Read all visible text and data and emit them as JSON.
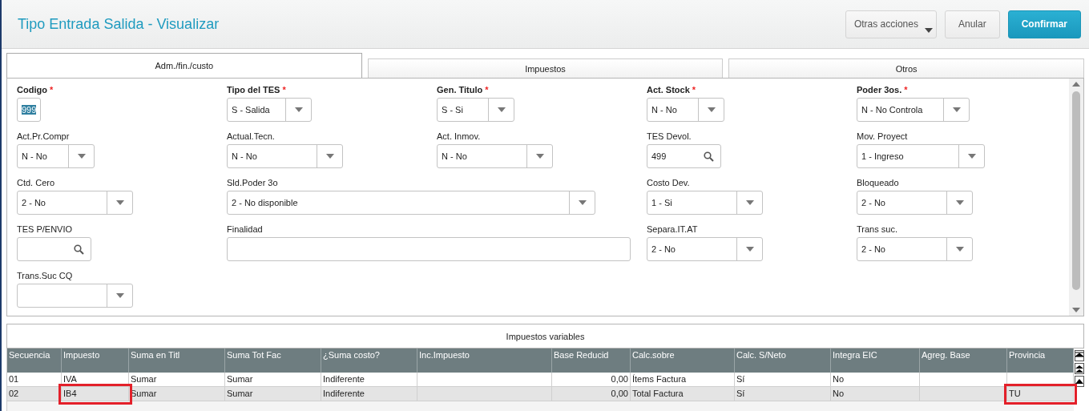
{
  "header": {
    "title": "Tipo Entrada Salida - Visualizar",
    "buttons": [
      {
        "label": "Otras acciones",
        "kind": "menu"
      },
      {
        "label": "Anular",
        "kind": "plain"
      },
      {
        "label": "Confirmar",
        "kind": "primary"
      }
    ]
  },
  "tabs": [
    {
      "label": "Adm./fin./custo",
      "selected": true
    },
    {
      "label": "Impuestos",
      "selected": false
    },
    {
      "label": "Otros",
      "selected": false
    }
  ],
  "form": {
    "rows": [
      [
        {
          "label": "Codigo",
          "required": true,
          "required_mark": "*",
          "kind": "text",
          "value": "999",
          "highlighted": true
        },
        {
          "label": "Tipo del TES",
          "required": true,
          "required_mark": "*",
          "kind": "select",
          "value": "S - Salida"
        },
        {
          "label": "Gen. Titulo",
          "required": true,
          "required_mark": "*",
          "kind": "select",
          "value": "S - Si"
        },
        {
          "label": "Act. Stock",
          "required": true,
          "required_mark": "*",
          "kind": "select",
          "value": "N - No"
        },
        {
          "label": "Poder 3os.",
          "required": true,
          "required_mark": "*",
          "kind": "select",
          "value": "N - No Controla"
        }
      ],
      [
        {
          "label": "Act.Pr.Compr",
          "required": false,
          "kind": "select",
          "value": "N - No"
        },
        {
          "label": "Actual.Tecn.",
          "required": false,
          "kind": "select",
          "value": "N - No"
        },
        {
          "label": "Act. Inmov.",
          "required": false,
          "kind": "select",
          "value": "N - No"
        },
        {
          "label": "TES Devol.",
          "required": false,
          "kind": "lookup",
          "value": "499"
        },
        {
          "label": "Mov. Proyect",
          "required": false,
          "kind": "select",
          "value": "1 - Ingreso"
        }
      ],
      [
        {
          "label": "Ctd. Cero",
          "required": false,
          "kind": "select",
          "value": "2 - No"
        },
        {
          "label": "Sld.Poder 3o",
          "required": false,
          "kind": "select",
          "value": "2 - No disponible"
        },
        {
          "label": "Costo Dev.",
          "required": false,
          "kind": "select",
          "value": "1 - Si"
        },
        {
          "label": "Bloqueado",
          "required": false,
          "kind": "select",
          "value": "2 - No"
        }
      ],
      [
        {
          "label": "TES P/ENVIO",
          "required": false,
          "kind": "lookup"
        },
        {
          "label": "Finalidad",
          "required": false,
          "kind": "text"
        },
        {
          "label": "Separa.IT.AT",
          "required": false,
          "kind": "select",
          "value": "2 - No"
        },
        {
          "label": "Trans suc.",
          "required": false,
          "kind": "select",
          "value": "2 - No"
        }
      ],
      [
        {
          "label": "Trans.Suc CQ",
          "required": false,
          "kind": "select"
        }
      ]
    ]
  },
  "grid": {
    "title": "Impuestos variables",
    "columns": [
      {
        "label": "Secuencia"
      },
      {
        "label": "Impuesto"
      },
      {
        "label": "Suma en Titl"
      },
      {
        "label": "Suma Tot Fac"
      },
      {
        "label": "¿Suma costo?"
      },
      {
        "label": "Inc.Impuesto"
      },
      {
        "label": "Base Reducid",
        "kind": "number"
      },
      {
        "label": "Calc.sobre"
      },
      {
        "label": "Calc. S/Neto"
      },
      {
        "label": "Integra EIC"
      },
      {
        "label": "Agreg. Base"
      },
      {
        "label": "Provincia"
      }
    ],
    "rows": [
      {
        "selected": false,
        "cells": [
          {
            "text": "01",
            "marked": false
          },
          {
            "text": "IVA",
            "marked": false
          },
          {
            "text": "Sumar",
            "marked": false
          },
          {
            "text": "Sumar",
            "marked": false
          },
          {
            "text": "Indiferente",
            "marked": false
          },
          {
            "marked": false
          },
          {
            "text": "0,00",
            "marked": false
          },
          {
            "text": "Ítems Factura",
            "marked": false
          },
          {
            "text": "Sí",
            "marked": false
          },
          {
            "text": "No",
            "marked": false
          },
          {
            "marked": false
          },
          {
            "marked": false
          }
        ]
      },
      {
        "selected": true,
        "cells": [
          {
            "text": "02",
            "marked": false
          },
          {
            "text": "IB4",
            "marked": true
          },
          {
            "text": "Sumar",
            "marked": false
          },
          {
            "text": "Sumar",
            "marked": false
          },
          {
            "text": "Indiferente",
            "marked": false
          },
          {
            "marked": false
          },
          {
            "text": "0,00",
            "marked": false
          },
          {
            "text": "Total Factura",
            "marked": false
          },
          {
            "text": "Sí",
            "marked": false
          },
          {
            "text": "No",
            "marked": false
          },
          {
            "marked": false
          },
          {
            "text": "TU",
            "marked": true
          }
        ]
      }
    ]
  }
}
